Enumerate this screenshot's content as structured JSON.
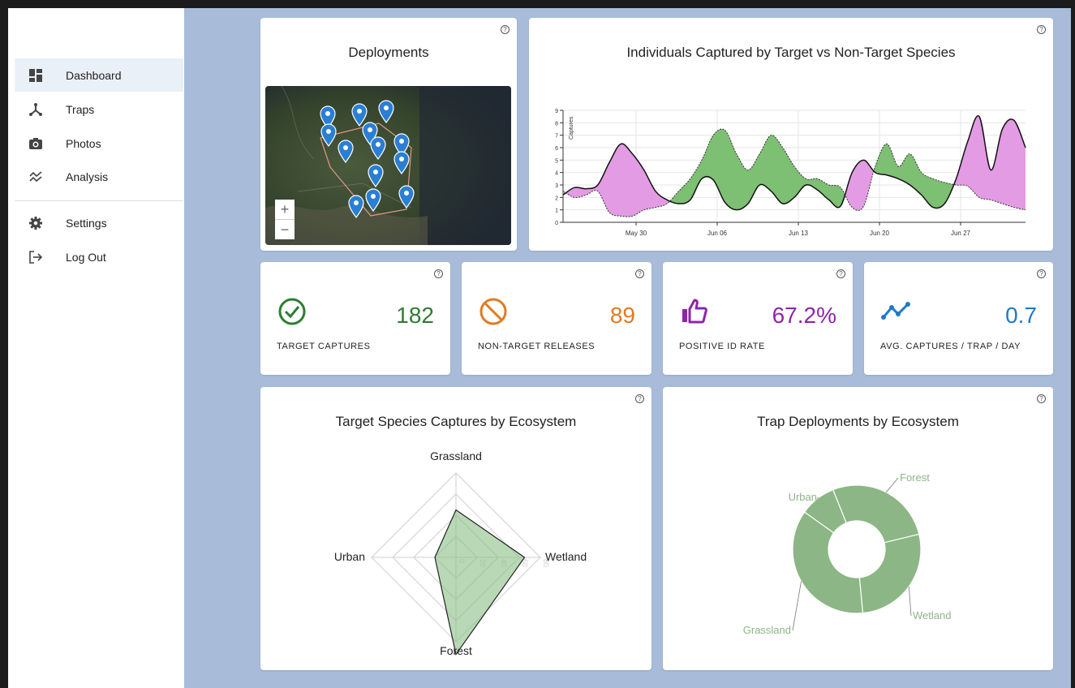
{
  "sidebar": {
    "items": [
      {
        "label": "Dashboard",
        "icon": "dashboard-icon",
        "active": true
      },
      {
        "label": "Traps",
        "icon": "trap-icon"
      },
      {
        "label": "Photos",
        "icon": "camera-icon"
      },
      {
        "label": "Analysis",
        "icon": "analysis-icon"
      },
      {
        "label": "Settings",
        "icon": "gear-icon"
      },
      {
        "label": "Log Out",
        "icon": "logout-icon"
      }
    ]
  },
  "help_glyph": "?",
  "deployments": {
    "title": "Deployments",
    "zoom_in": "+",
    "zoom_out": "−",
    "pin_count": 13
  },
  "stats": [
    {
      "label": "TARGET CAPTURES",
      "value": "182",
      "color": "#2e7d32",
      "icon": "check-circle-icon"
    },
    {
      "label": "NON-TARGET RELEASES",
      "value": "89",
      "color": "#e07b24",
      "icon": "block-icon"
    },
    {
      "label": "POSITIVE ID RATE",
      "value": "67.2%",
      "color": "#8e24aa",
      "icon": "thumbs-up-icon"
    },
    {
      "label": "AVG. CAPTURES / TRAP / DAY",
      "value": "0.7",
      "color": "#1e7ac9",
      "icon": "trend-icon"
    }
  ],
  "chart_data": [
    {
      "type": "area",
      "title": "Individuals Captured by Target vs Non-Target Species",
      "ylabel": "Captures",
      "ylim": [
        0,
        9
      ],
      "y_ticks": [
        "0",
        "1",
        "2",
        "3",
        "4",
        "5",
        "6",
        "7",
        "8",
        "9"
      ],
      "x_ticks": [
        "May 30",
        "Jun 06",
        "Jun 13",
        "Jun 20",
        "Jun 27"
      ],
      "xlim": [
        "May 24",
        "Jul 03"
      ],
      "series": [
        {
          "values": [
            2.2,
            2.8,
            2.7,
            3.0,
            4.8,
            6.3,
            5.5,
            4.2,
            2.5,
            1.8,
            1.5,
            1.8,
            3.5,
            3.4,
            1.6,
            1.0,
            1.5,
            3.0,
            2.5,
            1.5,
            2.0,
            3.0,
            2.6,
            1.8,
            1.3,
            4.0,
            5.0,
            4.0,
            3.8,
            3.5,
            3.0,
            2.2,
            1.2,
            1.5,
            3.5,
            6.5,
            8.5,
            4.2,
            7.5,
            8.2,
            6.0
          ]
        },
        {
          "values": [
            2.5,
            2.0,
            2.2,
            2.5,
            0.8,
            0.5,
            0.5,
            1.0,
            1.2,
            1.5,
            2.5,
            3.5,
            5.0,
            7.0,
            7.4,
            5.5,
            4.2,
            5.5,
            7.0,
            6.0,
            4.5,
            3.5,
            3.5,
            3.0,
            2.8,
            1.2,
            1.3,
            4.5,
            6.3,
            4.5,
            5.5,
            4.0,
            3.5,
            3.2,
            3.0,
            2.9,
            2.0,
            1.8,
            1.5,
            1.2,
            1.0
          ]
        }
      ],
      "colors": {
        "target_fill": "#7dbf73",
        "nontarget_fill": "#e39be3"
      }
    },
    {
      "type": "radar",
      "title": "Target Species Captures by Ecosystem",
      "categories": [
        "Grassland",
        "Wetland",
        "Forest",
        "Urban"
      ],
      "values": [
        45,
        65,
        100,
        20
      ],
      "rmax": 80,
      "r_ticks": [
        "0",
        "20",
        "40",
        "60",
        "80"
      ],
      "fill": "#8bbf85"
    },
    {
      "type": "pie",
      "title": "Trap Deployments by Ecosystem",
      "categories": [
        "Forest",
        "Wetland",
        "Grassland",
        "Urban"
      ],
      "values": [
        3,
        3,
        4,
        1
      ],
      "fill": "#8cb685",
      "label_color": "#8cb685"
    }
  ]
}
